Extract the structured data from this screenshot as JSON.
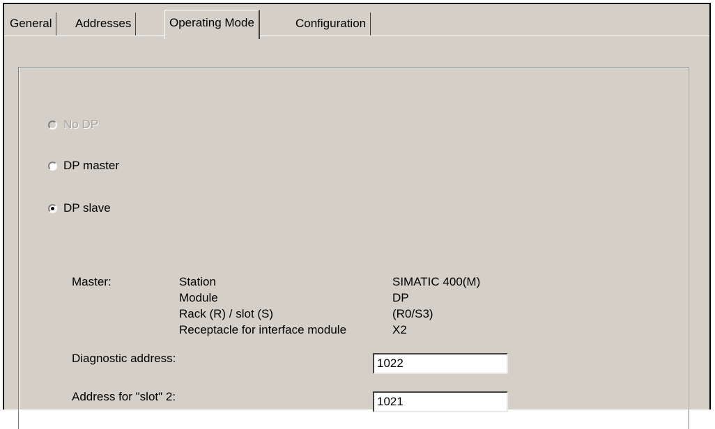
{
  "tabs": [
    {
      "label": "General",
      "active": false
    },
    {
      "label": "Addresses",
      "active": false
    },
    {
      "label": "Operating Mode",
      "active": true
    },
    {
      "label": "Configuration",
      "active": false
    }
  ],
  "operating_mode": {
    "options": [
      {
        "label": "No DP",
        "selected": false,
        "enabled": false
      },
      {
        "label": "DP master",
        "selected": false,
        "enabled": true
      },
      {
        "label": "DP slave",
        "selected": true,
        "enabled": true
      }
    ]
  },
  "master": {
    "label": "Master:",
    "rows": [
      {
        "key": "Station",
        "value": "SIMATIC 400(M)"
      },
      {
        "key": "Module",
        "value": "DP"
      },
      {
        "key": "Rack (R) / slot (S)",
        "value": "(R0/S3)"
      },
      {
        "key": "Receptacle for interface module",
        "value": "X2"
      }
    ]
  },
  "fields": {
    "diagnostic_address": {
      "label": "Diagnostic address:",
      "value": "1022"
    },
    "slot2_address": {
      "label": "Address for \"slot\" 2:",
      "value": "1021"
    }
  }
}
